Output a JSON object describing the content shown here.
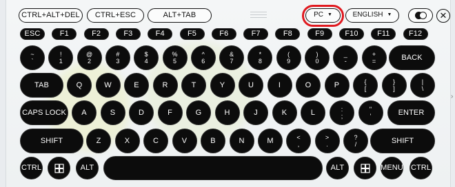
{
  "toolbar": {
    "ctrl_alt_del": "CTRL+ALT+DEL",
    "ctrl_esc": "CTRL+ESC",
    "alt_tab": "ALT+TAB",
    "layout_dropdown": "PC",
    "language_dropdown": "ENGLISH",
    "dropdown_caret": "▼",
    "close": "✕"
  },
  "function_row": [
    "ESC",
    "F1",
    "F2",
    "F3",
    "F4",
    "F5",
    "F6",
    "F7",
    "F8",
    "F9",
    "F10",
    "F11",
    "F12"
  ],
  "number_row": [
    {
      "top": "~",
      "bot": "`"
    },
    {
      "top": "!",
      "bot": "1"
    },
    {
      "top": "@",
      "bot": "2"
    },
    {
      "top": "#",
      "bot": "3"
    },
    {
      "top": "$",
      "bot": "4"
    },
    {
      "top": "%",
      "bot": "5"
    },
    {
      "top": "^",
      "bot": "6"
    },
    {
      "top": "&",
      "bot": "7"
    },
    {
      "top": "*",
      "bot": "8"
    },
    {
      "top": "(",
      "bot": "9"
    },
    {
      "top": ")",
      "bot": "0"
    },
    {
      "top": "_",
      "bot": "-"
    },
    {
      "top": "+",
      "bot": "="
    }
  ],
  "back_label": "BACK",
  "tab_label": "TAB",
  "qwerty_row": [
    "Q",
    "W",
    "E",
    "R",
    "T",
    "Y",
    "U",
    "I",
    "O",
    "P"
  ],
  "qwerty_symbols": [
    {
      "top": "{",
      "bot": "["
    },
    {
      "top": "}",
      "bot": "]"
    },
    {
      "top": "|",
      "bot": "\\"
    }
  ],
  "caps_label": "CAPS LOCK",
  "home_row": [
    "A",
    "S",
    "D",
    "F",
    "G",
    "H",
    "J",
    "K",
    "L"
  ],
  "home_symbols": [
    {
      "top": ":",
      "bot": ";"
    },
    {
      "top": "\"",
      "bot": "'"
    }
  ],
  "enter_label": "ENTER",
  "shift_label": "SHIFT",
  "bottom_row": [
    "Z",
    "X",
    "C",
    "V",
    "B",
    "N",
    "M"
  ],
  "bottom_symbols": [
    {
      "top": "<",
      "bot": ","
    },
    {
      "top": ">",
      "bot": "."
    },
    {
      "top": "?",
      "bot": "/"
    }
  ],
  "ctrl_label": "CTRL",
  "alt_label": "ALT",
  "menu_label": "MENU",
  "space_label": "",
  "colors": {
    "key_bg": "#0c0c0c",
    "key_text": "#ffffff",
    "highlight": "#e0191f",
    "panel_bg": "#f0f2f3"
  },
  "icons": {
    "windows_key": "windows-logo-icon",
    "theme_toggle": "theme-toggle-icon",
    "close": "close-icon",
    "drag_handle": "drag-handle-icon"
  }
}
